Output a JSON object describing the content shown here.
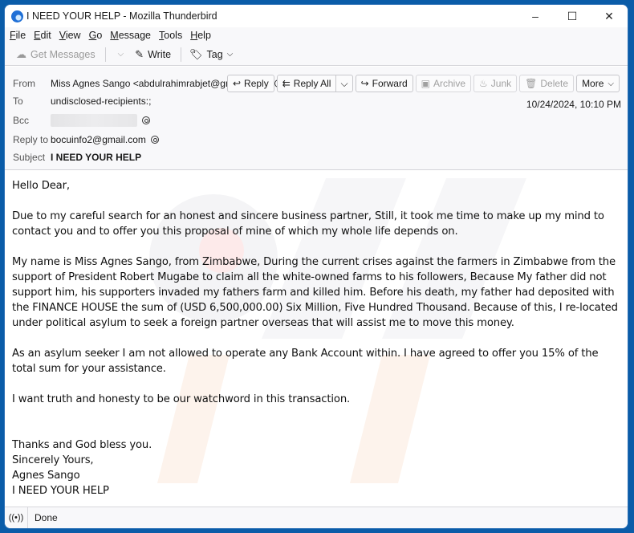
{
  "window": {
    "title": "I NEED YOUR HELP - Mozilla Thunderbird",
    "controls": {
      "minimize": "–",
      "maximize": "☐",
      "close": "✕"
    }
  },
  "menubar": {
    "items": [
      {
        "label": "File",
        "accel": "F",
        "rest": "ile"
      },
      {
        "label": "Edit",
        "accel": "E",
        "rest": "dit"
      },
      {
        "label": "View",
        "accel": "V",
        "rest": "iew"
      },
      {
        "label": "Go",
        "accel": "G",
        "rest": "o"
      },
      {
        "label": "Message",
        "accel": "M",
        "rest": "essage"
      },
      {
        "label": "Tools",
        "accel": "T",
        "rest": "ools"
      },
      {
        "label": "Help",
        "accel": "H",
        "rest": "elp"
      }
    ]
  },
  "toolbar": {
    "get_messages": "Get Messages",
    "write": "Write",
    "tag": "Tag"
  },
  "header": {
    "from_label": "From",
    "from_value": "Miss Agnes Sango <abdulrahimrabjet@gmail.com>",
    "to_label": "To",
    "to_value": "undisclosed-recipients:;",
    "bcc_label": "Bcc",
    "replyto_label": "Reply to",
    "replyto_value": "bocuinfo2@gmail.com",
    "subject_label": "Subject",
    "subject_value": "I NEED YOUR HELP",
    "date": "10/24/2024, 10:10 PM",
    "actions": {
      "reply": "Reply",
      "reply_all": "Reply All",
      "forward": "Forward",
      "archive": "Archive",
      "junk": "Junk",
      "delete": "Delete",
      "more": "More"
    }
  },
  "body": {
    "greeting": "Hello Dear,",
    "paragraphs": [
      "Due to my careful search for an honest and sincere business partner, Still, it took me time to make up my mind to contact you and to offer you this proposal of mine of which my whole life depends on.",
      "My name is Miss Agnes Sango, from Zimbabwe, During the current crises against the farmers in Zimbabwe from the support of President Robert Mugabe to claim all the white-owned farms to his followers, Because My father did not support him, his supporters invaded my fathers farm and killed him. Before his death, my father had deposited with the FINANCE HOUSE the sum of (USD 6,500,000.00) Six Million, Five Hundred Thousand. Because of this, I re-located under political asylum to seek a foreign partner overseas that will assist me to move this money.",
      "As an asylum seeker I am not allowed to operate any Bank Account within. I have agreed to offer you 15% of the total sum for your assistance.",
      "I want truth and honesty to be our watchword in this transaction."
    ],
    "signature": [
      "Thanks and God bless you.",
      "Sincerely Yours,",
      "Agnes Sango",
      "I NEED YOUR HELP"
    ]
  },
  "statusbar": {
    "text": "Done"
  }
}
